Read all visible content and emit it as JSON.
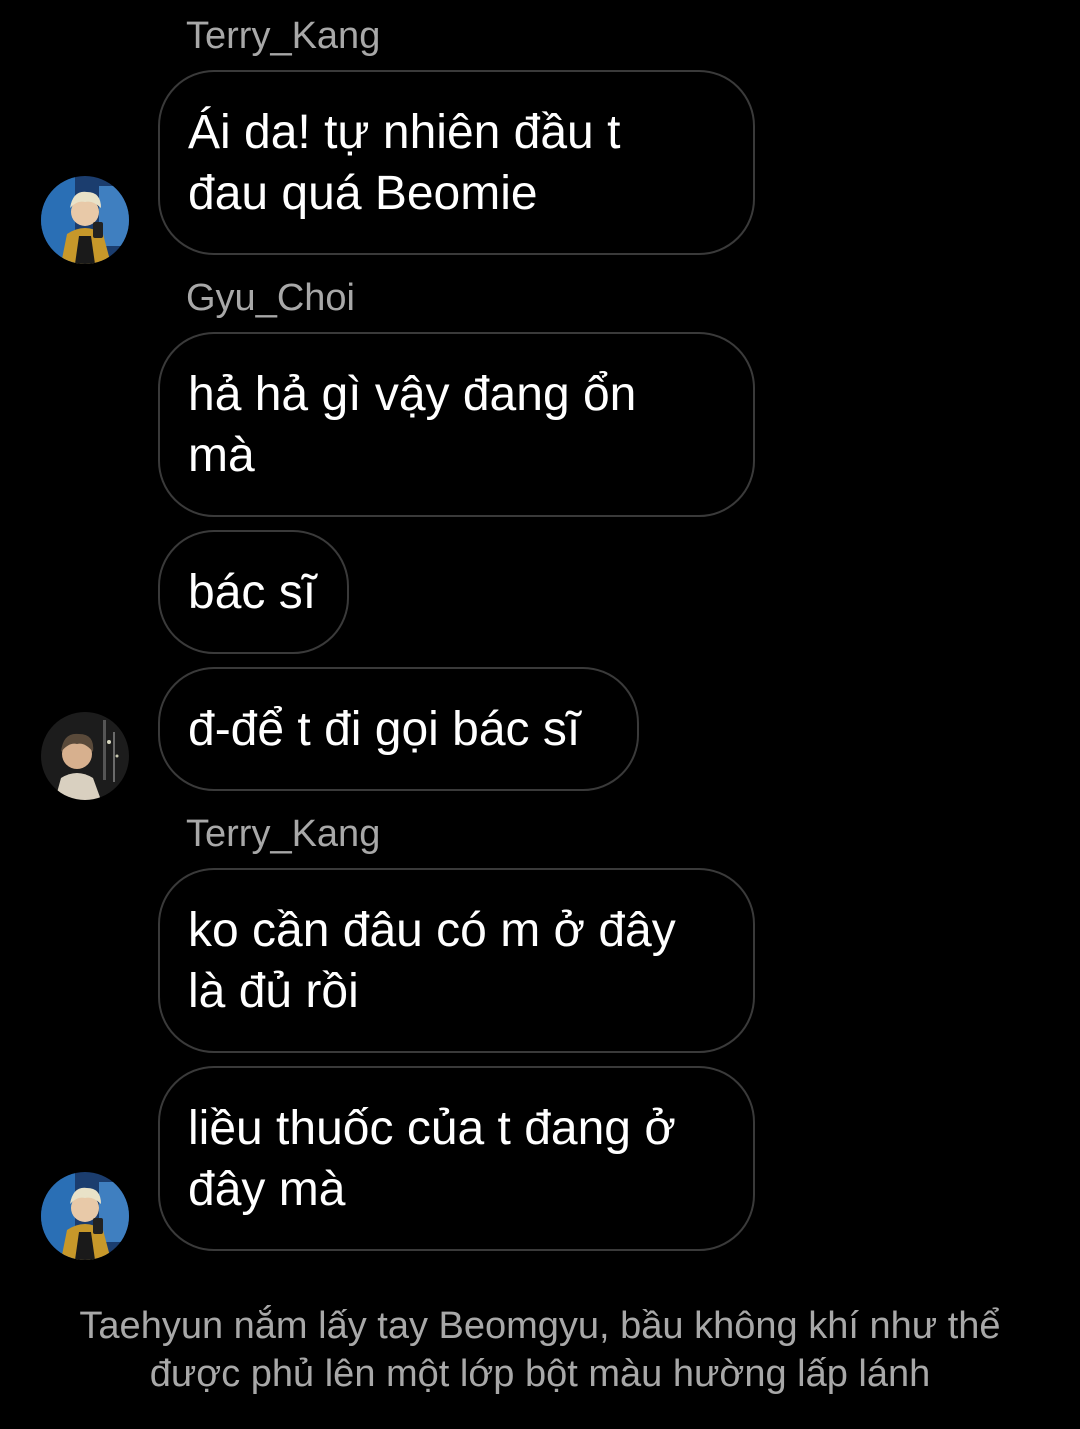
{
  "chat": {
    "messages": [
      {
        "sender": "Terry_Kang",
        "text": "Ái da! tự nhiên đầu t\nđau quá Beomie"
      },
      {
        "sender": "Gyu_Choi",
        "text": "hả hả gì vậy đang ổn\nmà"
      },
      {
        "sender": "",
        "text": "bác sĩ"
      },
      {
        "sender": "",
        "text": "đ-để t đi gọi bác sĩ"
      },
      {
        "sender": "Terry_Kang",
        "text": "ko cần đâu có m ở đây\nlà đủ rồi"
      },
      {
        "sender": "",
        "text": "liều thuốc của t đang ở\nđây mà"
      }
    ],
    "narration": "Taehyun nắm lấy tay Beomgyu, bầu không khí như thể được phủ lên một lớp bột màu hường lấp lánh"
  },
  "theme": {
    "background": "#000000",
    "bubble_border": "#3a3a3a",
    "text": "#ffffff",
    "muted_text": "#a8a8a8"
  },
  "avatars": {
    "terry_kang": "profile-photo-blond-hair-yellow-jacket",
    "gyu_choi": "profile-photo-dark-night-city"
  }
}
